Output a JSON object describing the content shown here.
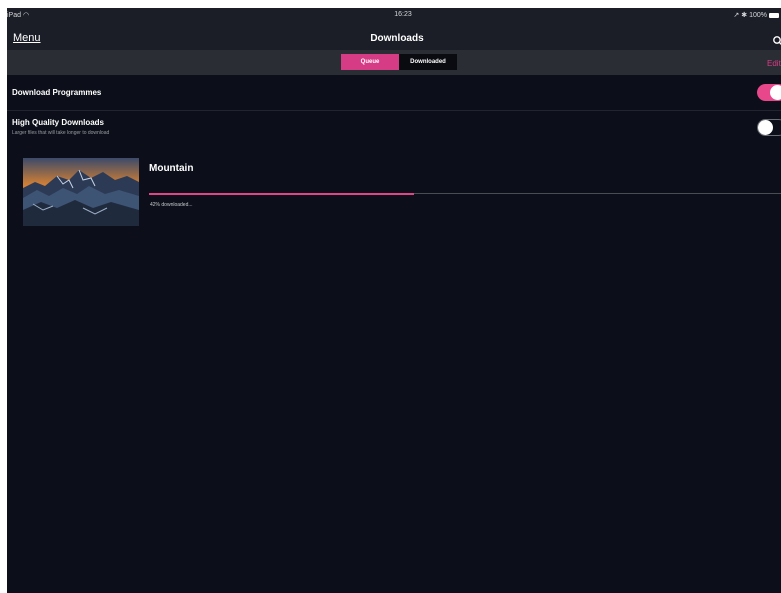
{
  "status_bar": {
    "device": "iPad",
    "wifi_icon": "wifi-icon",
    "time": "16:23",
    "right_indicators": "↗ ✱",
    "battery": "100%",
    "battery_icon": "battery-icon"
  },
  "nav": {
    "menu_label": "Menu",
    "title": "Downloads",
    "search_icon": "search-icon"
  },
  "segments": {
    "queue_label": "Queue",
    "downloaded_label": "Downloaded",
    "selected": "Queue",
    "edit_label": "Edit"
  },
  "settings": {
    "download_programmes": {
      "label": "Download Programmes",
      "enabled": true
    },
    "high_quality": {
      "label": "High Quality Downloads",
      "sublabel": "Larger files that will take longer to download",
      "enabled": false
    }
  },
  "queue_items": [
    {
      "title": "Mountain",
      "progress_percent": 42,
      "progress_text": "42% downloaded..."
    }
  ],
  "colors": {
    "accent": "#d63c86",
    "background": "#0c0f19",
    "bar": "#1b1e26"
  }
}
